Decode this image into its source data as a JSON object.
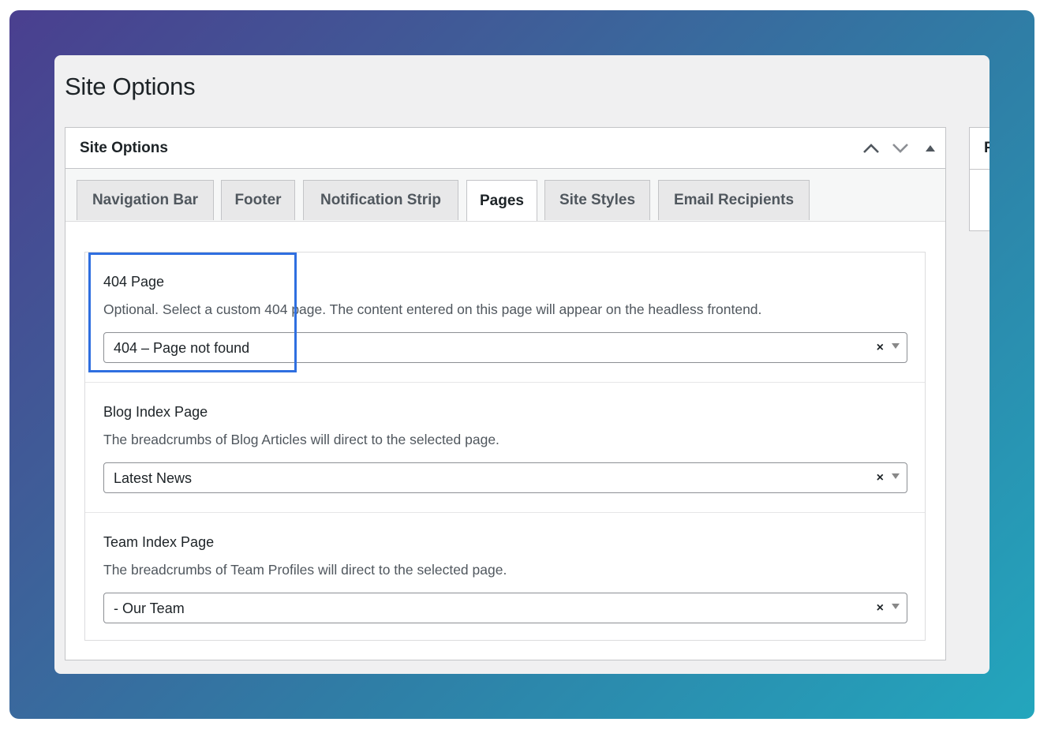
{
  "page": {
    "title": "Site Options"
  },
  "postbox": {
    "title": "Site Options",
    "controls": [
      "chevron-up-icon",
      "chevron-down-icon",
      "triangle-up-icon"
    ]
  },
  "tabs": [
    {
      "label": "Navigation Bar",
      "active": false
    },
    {
      "label": "Footer",
      "active": false
    },
    {
      "label": "Notification Strip",
      "active": false
    },
    {
      "label": "Pages",
      "active": true
    },
    {
      "label": "Site Styles",
      "active": false
    },
    {
      "label": "Email Recipients",
      "active": false
    }
  ],
  "fields": [
    {
      "label": "404 Page",
      "description": "Optional. Select a custom 404 page. The content entered on this page will appear on the headless frontend.",
      "value": "404 – Page not found",
      "clear": "×"
    },
    {
      "label": "Blog Index Page",
      "description": "The breadcrumbs of Blog Articles will direct to the selected page.",
      "value": "Latest News",
      "clear": "×"
    },
    {
      "label": "Team Index Page",
      "description": "The breadcrumbs of Team Profiles will direct to the selected page.",
      "value": "- Our Team",
      "clear": "×"
    }
  ],
  "side_box": {
    "title_partial": "P"
  },
  "colors": {
    "highlight": "#2f6fe0",
    "accent_bg_start": "#4a3f8f",
    "accent_bg_end": "#23a6bd"
  }
}
